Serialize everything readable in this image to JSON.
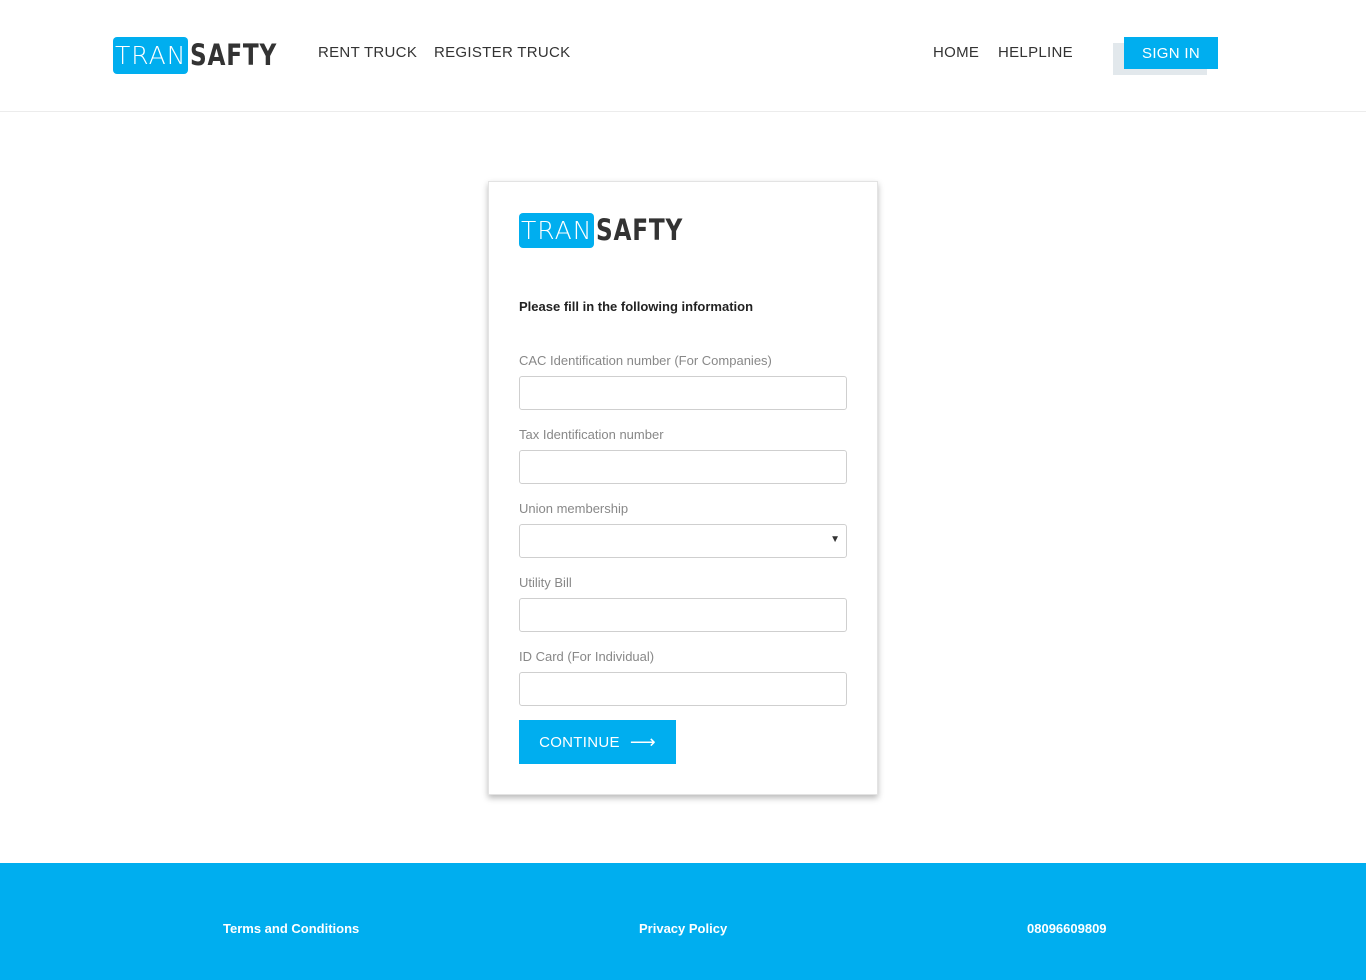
{
  "brand": {
    "part1": "TRAN",
    "part2": "SAFTY",
    "accent_color": "#00aeef"
  },
  "nav": {
    "rent_truck": "RENT TRUCK",
    "register_truck": "REGISTER TRUCK",
    "home": "HOME",
    "helpline": "HELPLINE",
    "sign_in": "SIGN IN"
  },
  "form": {
    "intro": "Please fill in the following information",
    "fields": [
      {
        "label": "CAC Identification number (For Companies)",
        "value": "",
        "type": "text"
      },
      {
        "label": "Tax Identification number",
        "value": "",
        "type": "text"
      },
      {
        "label": "Union membership",
        "value": "",
        "type": "select"
      },
      {
        "label": "Utility Bill",
        "value": "",
        "type": "text"
      },
      {
        "label": "ID Card (For Individual)",
        "value": "",
        "type": "text"
      }
    ],
    "continue_label": "CONTINUE",
    "continue_icon": "arrow-right-icon"
  },
  "footer": {
    "terms": "Terms and Conditions",
    "privacy": "Privacy Policy",
    "phone": "08096609809"
  }
}
